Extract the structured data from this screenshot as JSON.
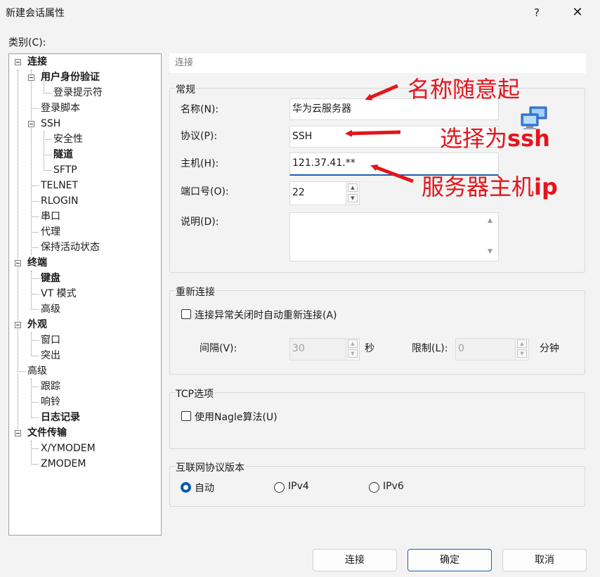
{
  "window": {
    "title": "新建会话属性",
    "help": "?",
    "close": "✕"
  },
  "category_label": "类别(C):",
  "tree": [
    {
      "label": "连接",
      "bold": true
    },
    {
      "label": "用户身份验证",
      "bold": true
    },
    {
      "label": "登录提示符",
      "bold": false
    },
    {
      "label": "登录脚本",
      "bold": false
    },
    {
      "label": "SSH",
      "bold": false
    },
    {
      "label": "安全性",
      "bold": false
    },
    {
      "label": "隧道",
      "bold": true
    },
    {
      "label": "SFTP",
      "bold": false
    },
    {
      "label": "TELNET",
      "bold": false
    },
    {
      "label": "RLOGIN",
      "bold": false
    },
    {
      "label": "串口",
      "bold": false
    },
    {
      "label": "代理",
      "bold": false
    },
    {
      "label": "保持活动状态",
      "bold": false
    },
    {
      "label": "终端",
      "bold": true
    },
    {
      "label": "键盘",
      "bold": true
    },
    {
      "label": "VT 模式",
      "bold": false
    },
    {
      "label": "高级",
      "bold": false
    },
    {
      "label": "外观",
      "bold": true
    },
    {
      "label": "窗口",
      "bold": false
    },
    {
      "label": "突出",
      "bold": false
    },
    {
      "label": "高级",
      "bold": false
    },
    {
      "label": "跟踪",
      "bold": false
    },
    {
      "label": "响铃",
      "bold": false
    },
    {
      "label": "日志记录",
      "bold": true
    },
    {
      "label": "文件传输",
      "bold": true
    },
    {
      "label": "X/YMODEM",
      "bold": false
    },
    {
      "label": "ZMODEM",
      "bold": false
    }
  ],
  "pane_header": "连接",
  "general": {
    "title": "常规",
    "name_label": "名称(N):",
    "name_value": "华为云服务器",
    "protocol_label": "协议(P):",
    "protocol_value": "SSH",
    "host_label": "主机(H):",
    "host_value": "121.37.41.**",
    "port_label": "端口号(O):",
    "port_value": "22",
    "desc_label": "说明(D):",
    "desc_value": ""
  },
  "reconnect": {
    "title": "重新连接",
    "checkbox_label": "连接异常关闭时自动重新连接(A)",
    "interval_label": "间隔(V):",
    "interval_value": "30",
    "interval_unit": "秒",
    "limit_label": "限制(L):",
    "limit_value": "0",
    "limit_unit": "分钟"
  },
  "tcp": {
    "title": "TCP选项",
    "checkbox_label": "使用Nagle算法(U)"
  },
  "ip_version": {
    "title": "互联网协议版本",
    "options": [
      "自动",
      "IPv4",
      "IPv6"
    ],
    "selected": "自动"
  },
  "buttons": {
    "connect": "连接",
    "ok": "确定",
    "cancel": "取消"
  },
  "annotations": {
    "name": "名称随意起",
    "protocol_prefix": "选择为",
    "protocol_suffix": "ssh",
    "host_prefix": "服务器主机",
    "host_suffix": "ip"
  },
  "colors": {
    "annotation": "#e5141b",
    "accent": "#1a5fb4"
  }
}
